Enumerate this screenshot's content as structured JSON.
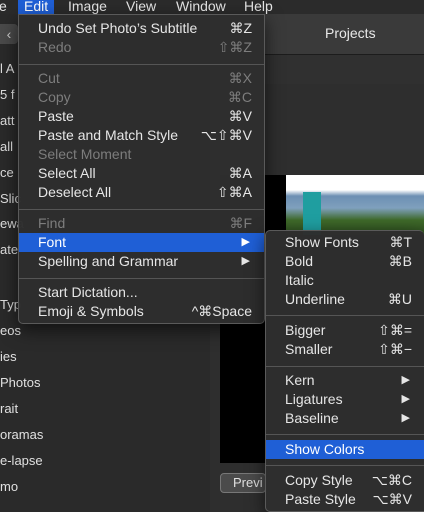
{
  "menubar": {
    "items": [
      {
        "label": "e"
      },
      {
        "label": "Edit"
      },
      {
        "label": "Image"
      },
      {
        "label": "View"
      },
      {
        "label": "Window"
      },
      {
        "label": "Help"
      }
    ]
  },
  "window": {
    "title": "Projects",
    "back_glyph": "‹",
    "preview_label": "Previ"
  },
  "sidebar": {
    "fragments": [
      "l A",
      "5 f",
      "att",
      "all",
      "ce",
      "Slic",
      "ewa",
      "ate",
      "Typ",
      "eos",
      "ies",
      "Photos",
      "rait",
      "oramas",
      "e-lapse",
      "mo"
    ]
  },
  "edit_menu": {
    "items": [
      {
        "label": "Undo Set Photo’s Subtitle",
        "shortcut": "⌘Z"
      },
      {
        "label": "Redo",
        "shortcut": "⇧⌘Z"
      },
      {
        "label": "Cut",
        "shortcut": "⌘X"
      },
      {
        "label": "Copy",
        "shortcut": "⌘C"
      },
      {
        "label": "Paste",
        "shortcut": "⌘V"
      },
      {
        "label": "Paste and Match Style",
        "shortcut": "⌥⇧⌘V"
      },
      {
        "label": "Select Moment",
        "shortcut": ""
      },
      {
        "label": "Select All",
        "shortcut": "⌘A"
      },
      {
        "label": "Deselect All",
        "shortcut": "⇧⌘A"
      },
      {
        "label": "Find",
        "shortcut": "⌘F"
      },
      {
        "label": "Font",
        "shortcut": "▶"
      },
      {
        "label": "Spelling and Grammar",
        "shortcut": "▶"
      },
      {
        "label": "Start Dictation...",
        "shortcut": ""
      },
      {
        "label": "Emoji & Symbols",
        "shortcut": "^⌘Space"
      }
    ]
  },
  "font_menu": {
    "items": [
      {
        "label": "Show Fonts",
        "shortcut": "⌘T"
      },
      {
        "label": "Bold",
        "shortcut": "⌘B"
      },
      {
        "label": "Italic",
        "shortcut": ""
      },
      {
        "label": "Underline",
        "shortcut": "⌘U"
      },
      {
        "label": "Bigger",
        "shortcut": "⇧⌘="
      },
      {
        "label": "Smaller",
        "shortcut": "⇧⌘−"
      },
      {
        "label": "Kern",
        "shortcut": "▶"
      },
      {
        "label": "Ligatures",
        "shortcut": "▶"
      },
      {
        "label": "Baseline",
        "shortcut": "▶"
      },
      {
        "label": "Show Colors",
        "shortcut": ""
      },
      {
        "label": "Copy Style",
        "shortcut": "⌥⌘C"
      },
      {
        "label": "Paste Style",
        "shortcut": "⌥⌘V"
      }
    ]
  },
  "colors": {
    "highlight": "#1f5fd6",
    "menu_bg": "#2e2e2e",
    "disabled_text": "#7d7d7d"
  }
}
